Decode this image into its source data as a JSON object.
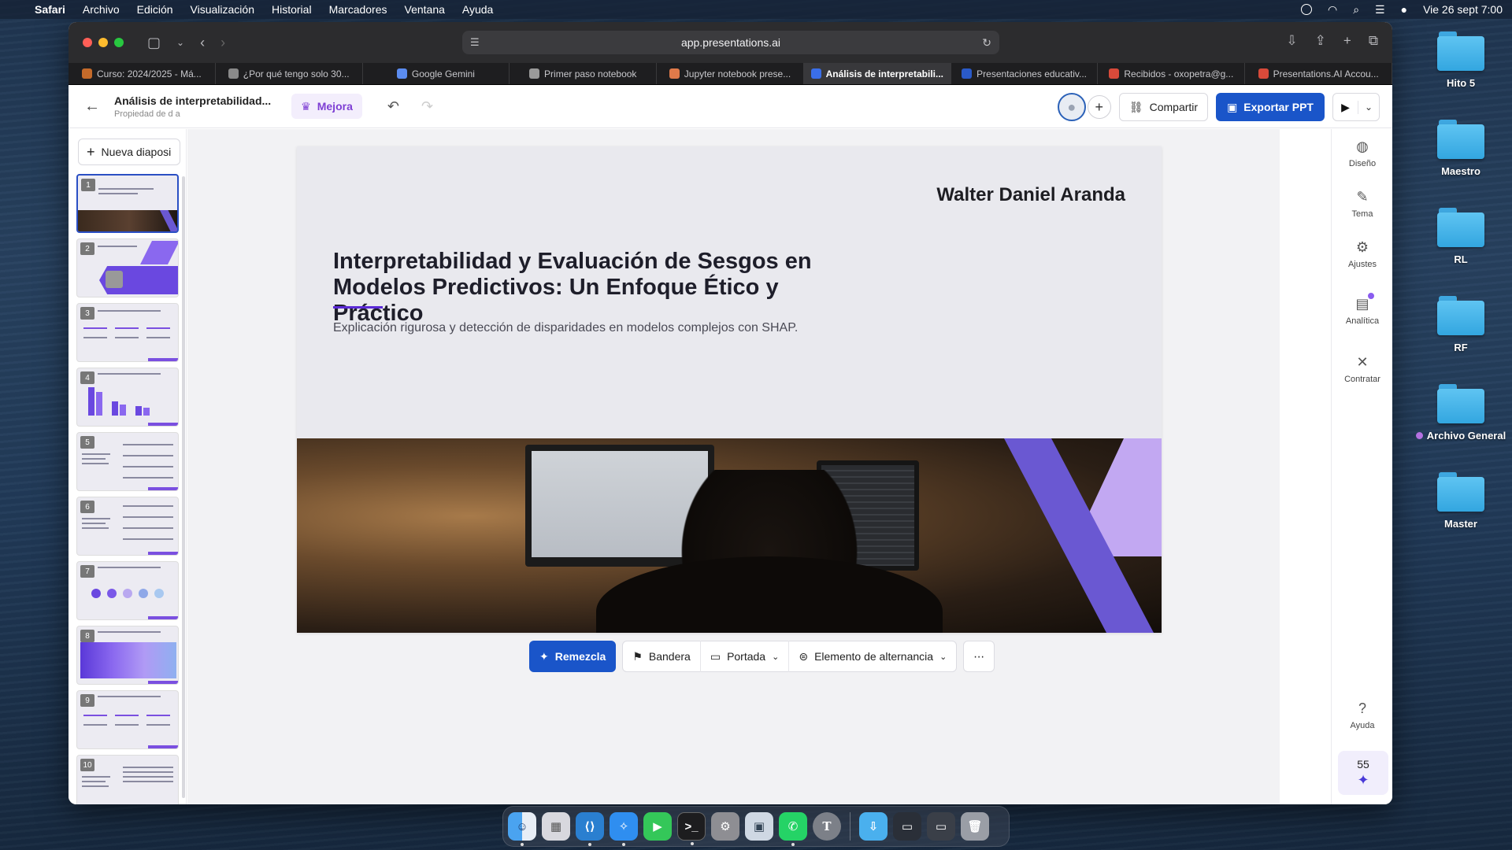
{
  "menubar": {
    "app": "Safari",
    "items": [
      "Archivo",
      "Edición",
      "Visualización",
      "Historial",
      "Marcadores",
      "Ventana",
      "Ayuda"
    ],
    "datetime": "Vie 26 sept 7:00"
  },
  "desktop": {
    "folders": [
      "Hito 5",
      "Maestro",
      "RL",
      "RF",
      "Archivo General",
      "Master"
    ]
  },
  "browser": {
    "url": "app.presentations.ai",
    "tabs": [
      {
        "label": "Curso: 2024/2025 - Má...",
        "color": "#c46a2a"
      },
      {
        "label": "¿Por qué tengo solo 30...",
        "color": "#8a8a8a"
      },
      {
        "label": "Google Gemini",
        "color": "#5b8cf0"
      },
      {
        "label": "Primer paso notebook",
        "color": "#9a9a9a"
      },
      {
        "label": "Jupyter notebook prese...",
        "color": "#e07a4a"
      },
      {
        "label": "Análisis de interpretabili...",
        "color": "#3a6ee8"
      },
      {
        "label": "Presentaciones educativ...",
        "color": "#2a5ac8"
      },
      {
        "label": "Recibidos - oxopetra@g...",
        "color": "#d84a3a"
      },
      {
        "label": "Presentations.AI Accou...",
        "color": "#d84a3a"
      }
    ]
  },
  "header": {
    "title": "Análisis de interpretabilidad...",
    "subtitle": "Propiedad de d a",
    "upgrade_label": "Mejora",
    "share_label": "Compartir",
    "export_label": "Exportar PPT"
  },
  "sidebar": {
    "new_slide_label": "Nueva diaposi",
    "slide_numbers": [
      "1",
      "2",
      "3",
      "4",
      "5",
      "6",
      "7",
      "8",
      "9",
      "10"
    ]
  },
  "slide": {
    "author": "Walter Daniel Aranda",
    "title": "Interpretabilidad y Evaluación de Sesgos en Modelos Predictivos: Un Enfoque Ético y Práctico",
    "subtitle": "Explicación rigurosa y detección de disparidades en modelos complejos con SHAP."
  },
  "bottom_toolbar": {
    "remix_label": "Remezcla",
    "flag_label": "Bandera",
    "cover_label": "Portada",
    "toggle_label": "Elemento de alternancia"
  },
  "right_panel": {
    "items": [
      "Diseño",
      "Tema",
      "Ajustes",
      "Analítica",
      "Contratar"
    ],
    "help_label": "Ayuda",
    "credits": "55"
  },
  "colors": {
    "accent": "#1a55c9",
    "purple": "#5b2ad6",
    "upgrade": "#7e3fd4"
  }
}
